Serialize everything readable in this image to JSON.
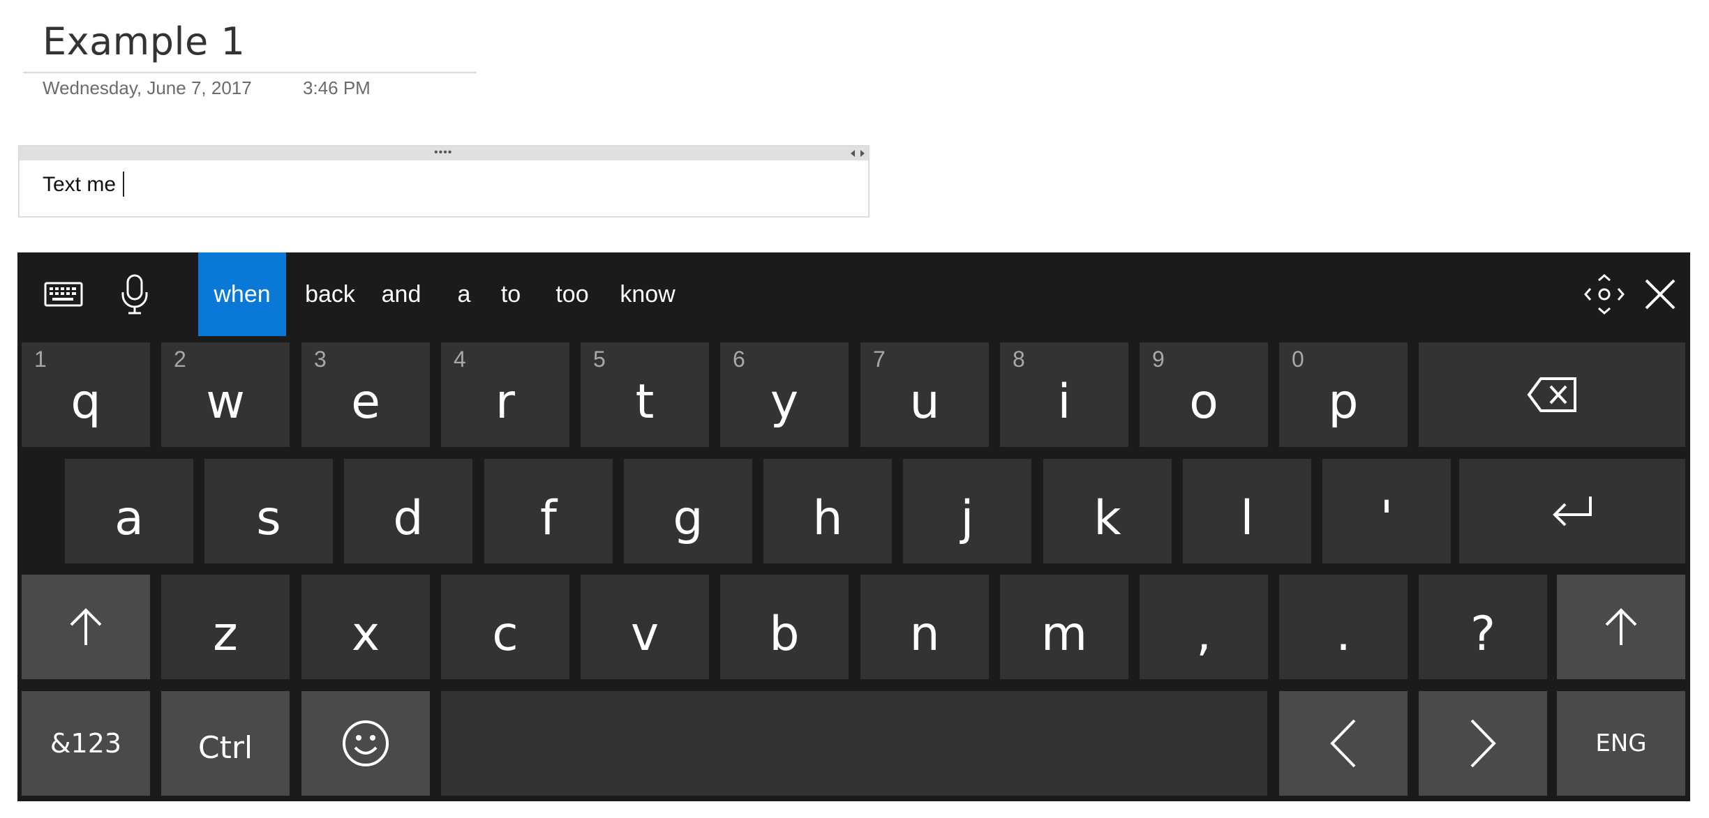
{
  "page": {
    "title": "Example 1",
    "date": "Wednesday, June 7, 2017",
    "time": "3:46 PM"
  },
  "note": {
    "text": "Text me",
    "grip": "••••"
  },
  "keyboard": {
    "toolbar": {
      "keyboard_icon": "keyboard-icon",
      "mic_icon": "microphone-icon",
      "move_icon": "move-icon",
      "close_icon": "close-icon"
    },
    "suggestions": [
      "when",
      "back",
      "and",
      "a",
      "to",
      "too",
      "know"
    ],
    "selected_suggestion": "when",
    "accent_color": "#0a78d7",
    "row1": [
      {
        "num": "1",
        "ch": "q"
      },
      {
        "num": "2",
        "ch": "w"
      },
      {
        "num": "3",
        "ch": "e"
      },
      {
        "num": "4",
        "ch": "r"
      },
      {
        "num": "5",
        "ch": "t"
      },
      {
        "num": "6",
        "ch": "y"
      },
      {
        "num": "7",
        "ch": "u"
      },
      {
        "num": "8",
        "ch": "i"
      },
      {
        "num": "9",
        "ch": "o"
      },
      {
        "num": "0",
        "ch": "p"
      }
    ],
    "row2": [
      "a",
      "s",
      "d",
      "f",
      "g",
      "h",
      "j",
      "k",
      "l",
      "'"
    ],
    "row3": [
      "z",
      "x",
      "c",
      "v",
      "b",
      "n",
      "m",
      ",",
      ".",
      "?"
    ],
    "bottom": {
      "symbols_label": "&123",
      "ctrl_label": "Ctrl",
      "emoji_icon": "emoji-icon",
      "left_icon": "arrow-left-icon",
      "right_icon": "arrow-right-icon",
      "lang_label": "ENG"
    },
    "backspace_icon": "backspace-icon",
    "enter_icon": "enter-icon",
    "shift_icon": "shift-icon"
  }
}
